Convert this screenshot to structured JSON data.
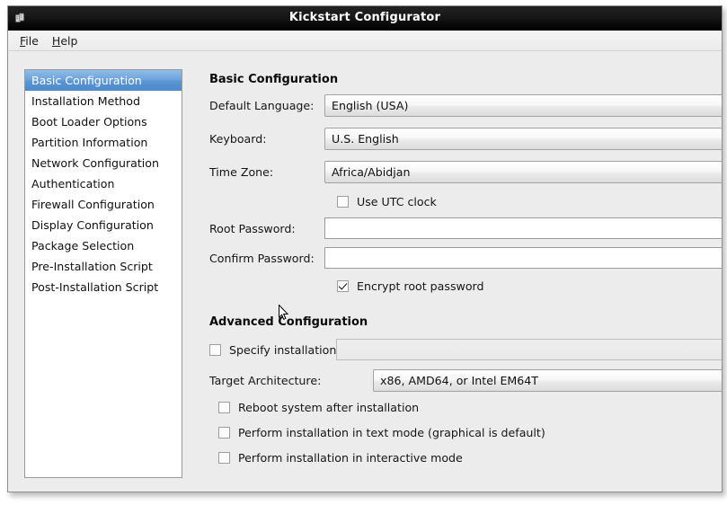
{
  "window": {
    "title": "Kickstart Configurator",
    "icon": "app-icon"
  },
  "menubar": {
    "items": [
      {
        "label": "File",
        "mnemonic": "F"
      },
      {
        "label": "Help",
        "mnemonic": "H"
      }
    ]
  },
  "sidebar": {
    "items": [
      {
        "label": "Basic Configuration",
        "selected": true
      },
      {
        "label": "Installation Method",
        "selected": false
      },
      {
        "label": "Boot Loader Options",
        "selected": false
      },
      {
        "label": "Partition Information",
        "selected": false
      },
      {
        "label": "Network Configuration",
        "selected": false
      },
      {
        "label": "Authentication",
        "selected": false
      },
      {
        "label": "Firewall Configuration",
        "selected": false
      },
      {
        "label": "Display Configuration",
        "selected": false
      },
      {
        "label": "Package Selection",
        "selected": false
      },
      {
        "label": "Pre-Installation Script",
        "selected": false
      },
      {
        "label": "Post-Installation Script",
        "selected": false
      }
    ]
  },
  "basic": {
    "heading": "Basic Configuration",
    "language": {
      "label": "Default Language:",
      "value": "English (USA)"
    },
    "keyboard": {
      "label": "Keyboard:",
      "value": "U.S. English"
    },
    "timezone": {
      "label": "Time Zone:",
      "value": "Africa/Abidjan"
    },
    "utc": {
      "label": "Use UTC clock",
      "checked": false
    },
    "root_password": {
      "label": "Root Password:",
      "value": ""
    },
    "confirm_password": {
      "label": "Confirm Password:",
      "value": ""
    },
    "encrypt": {
      "label": "Encrypt root password",
      "checked": true
    }
  },
  "advanced": {
    "heading": "Advanced Configuration",
    "install_key": {
      "label": "Specify installation key:",
      "checked": false,
      "value": "",
      "enabled": false
    },
    "target_arch": {
      "label": "Target Architecture:",
      "value": "x86, AMD64, or Intel EM64T"
    },
    "reboot": {
      "label": "Reboot system after installation",
      "checked": false
    },
    "text_mode": {
      "label": "Perform installation in text mode (graphical is default)",
      "checked": false
    },
    "interactive": {
      "label": "Perform installation in interactive mode",
      "checked": false
    }
  },
  "colors": {
    "titlebar": "#0d0d0d",
    "selection": "#5b96d4",
    "window_bg": "#ececec"
  }
}
